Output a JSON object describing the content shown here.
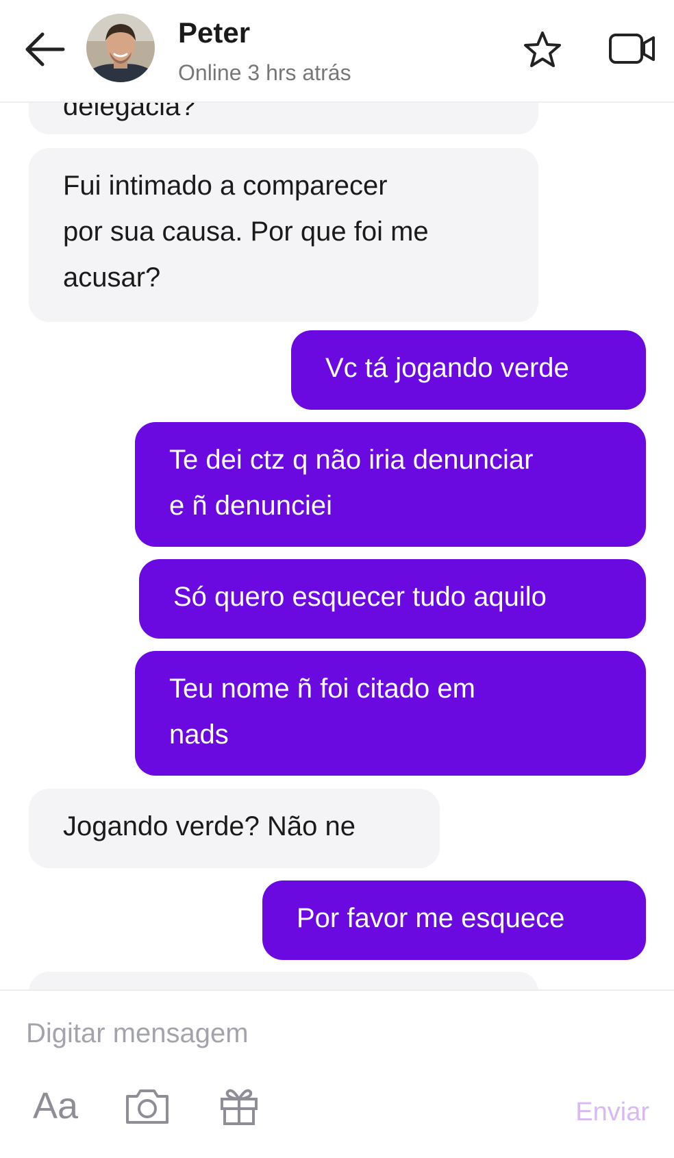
{
  "header": {
    "contact_name": "Peter",
    "status": "Online 3 hrs atrás"
  },
  "messages": [
    {
      "direction": "in",
      "text": "delegacia?"
    },
    {
      "direction": "in",
      "text": "Fui intimado a comparecer\npor sua causa. Por que foi me\nacusar?"
    },
    {
      "direction": "out",
      "text": "Vc tá jogando verde"
    },
    {
      "direction": "out",
      "text": "Te dei ctz q não iria denunciar\ne ñ denunciei"
    },
    {
      "direction": "out",
      "text": "Só quero esquecer tudo aquilo"
    },
    {
      "direction": "out",
      "text": "Teu nome ñ foi citado em\nnads"
    },
    {
      "direction": "in",
      "text": "Jogando verde? Não ne"
    },
    {
      "direction": "out",
      "text": "Por favor me esquece"
    }
  ],
  "composer": {
    "placeholder": "Digitar mensagem",
    "text_format_label": "Aa",
    "send_label": "Enviar"
  },
  "colors": {
    "outgoing_bubble": "#6a0ae0",
    "incoming_bubble": "#f4f4f6",
    "send_disabled": "#d7b9f4"
  },
  "icons": [
    "back-arrow-icon",
    "star-icon",
    "video-camera-icon",
    "camera-icon",
    "gift-icon"
  ]
}
